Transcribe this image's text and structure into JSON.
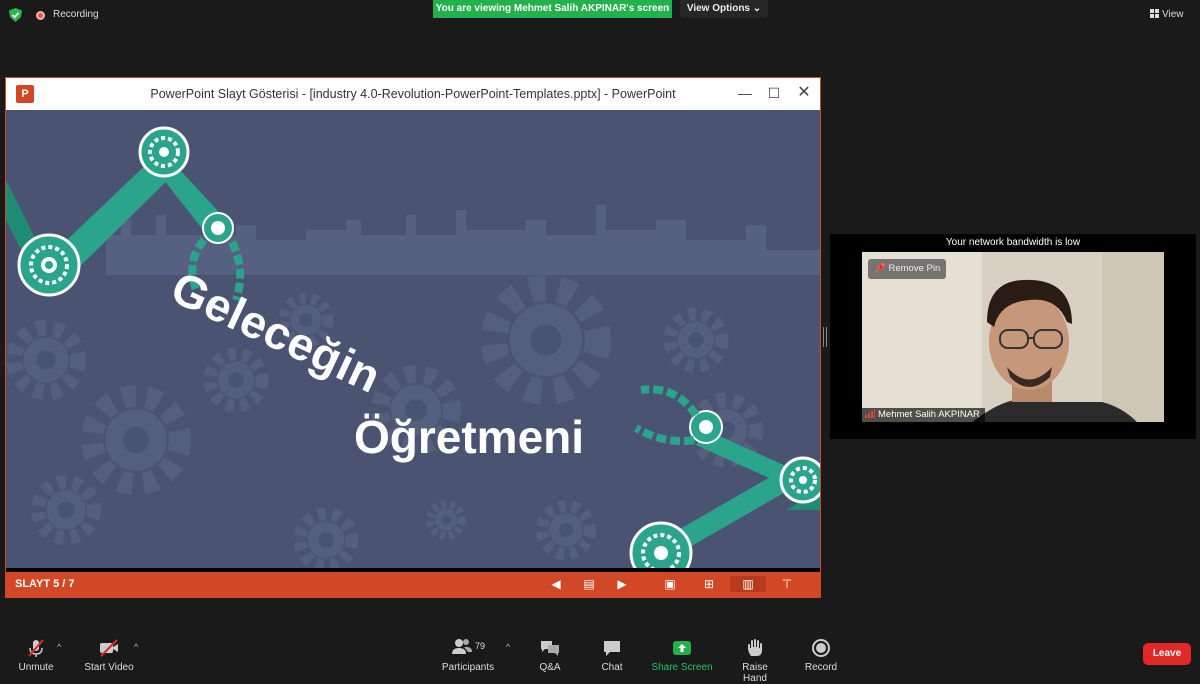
{
  "topbar": {
    "recording_label": "Recording",
    "viewing_banner": "You are viewing Mehmet Salih AKPINAR's screen",
    "view_options": "View Options",
    "view_label": "View"
  },
  "powerpoint": {
    "window_title": "PowerPoint Slayt Gösterisi - [industry 4.0-Revolution-PowerPoint-Templates.pptx] - PowerPoint",
    "slide_text_line1": "Geleceğin",
    "slide_text_line2": "Öğretmeni",
    "slide_counter": "SLAYT 5 / 7"
  },
  "video": {
    "bandwidth_notice": "Your network bandwidth is low",
    "remove_pin_label": "Remove Pin",
    "participant_name": "Mehmet Salih AKPINAR"
  },
  "toolbar": {
    "unmute": "Unmute",
    "start_video": "Start Video",
    "participants": "Participants",
    "participants_count": "79",
    "qa": "Q&A",
    "chat": "Chat",
    "share_screen": "Share Screen",
    "raise_hand": "Raise Hand",
    "record": "Record",
    "leave": "Leave"
  },
  "colors": {
    "zoom_green": "#22b14c",
    "ppt_orange": "#d24726",
    "slide_bg": "#4a5472",
    "robot_teal": "#2aa58c",
    "leave_red": "#e02828"
  }
}
